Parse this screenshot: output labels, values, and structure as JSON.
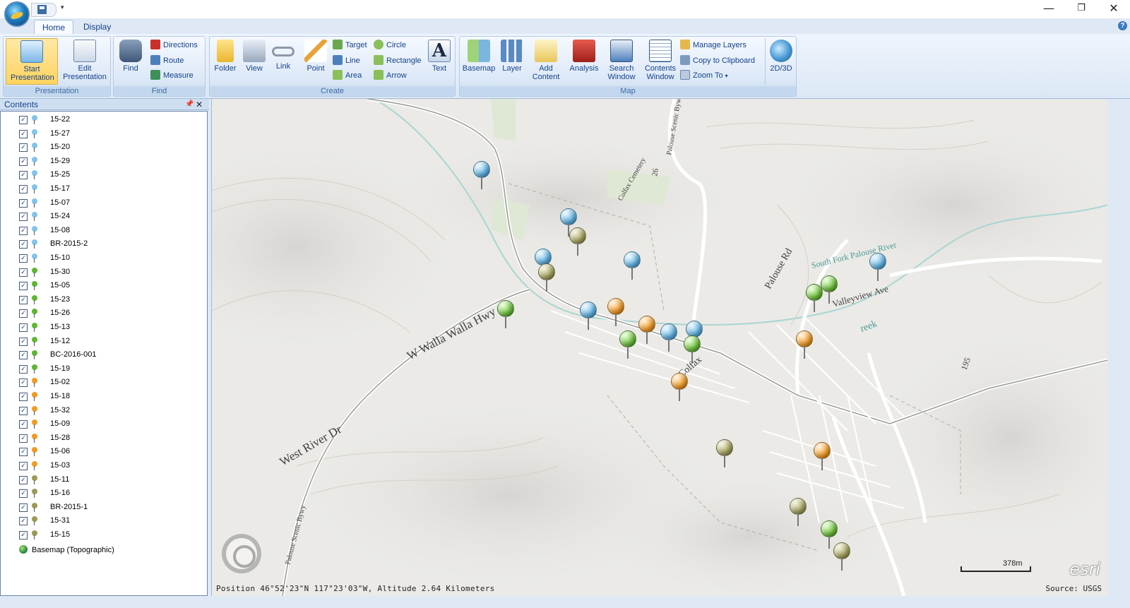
{
  "titlebar": {
    "qat_dropdown": "▾",
    "minimize": "—",
    "maximize": "❐",
    "close": "✕"
  },
  "tabs": [
    {
      "label": "Home"
    },
    {
      "label": "Display"
    }
  ],
  "ribbon": {
    "presentation": {
      "label": "Presentation",
      "start": "Start Presentation",
      "edit": "Edit Presentation"
    },
    "find": {
      "label": "Find",
      "find": "Find",
      "directions": "Directions",
      "route": "Route",
      "measure": "Measure"
    },
    "create": {
      "label": "Create",
      "folder": "Folder",
      "view": "View",
      "link": "Link",
      "point": "Point",
      "target": "Target",
      "line": "Line",
      "area": "Area",
      "circle": "Circle",
      "rectangle": "Rectangle",
      "arrow": "Arrow",
      "text": "Text"
    },
    "map": {
      "label": "Map",
      "basemap": "Basemap",
      "layer": "Layer",
      "add_content": "Add Content",
      "analysis": "Analysis",
      "search_window": "Search Window",
      "contents_window": "Contents Window",
      "manage_layers": "Manage Layers",
      "copy_clipboard": "Copy to Clipboard",
      "zoom_to": "Zoom To",
      "toggle_3d": "2D/3D"
    }
  },
  "contents": {
    "title": "Contents",
    "layers": [
      {
        "label": "15-22",
        "color": "#7fc4ec"
      },
      {
        "label": "15-27",
        "color": "#7fc4ec"
      },
      {
        "label": "15-20",
        "color": "#7fc4ec"
      },
      {
        "label": "15-29",
        "color": "#7fc4ec"
      },
      {
        "label": "15-25",
        "color": "#7fc4ec"
      },
      {
        "label": "15-17",
        "color": "#7fc4ec"
      },
      {
        "label": "15-07",
        "color": "#7fc4ec"
      },
      {
        "label": "15-24",
        "color": "#7fc4ec"
      },
      {
        "label": "15-08",
        "color": "#7fc4ec"
      },
      {
        "label": "BR-2015-2",
        "color": "#7fc4ec"
      },
      {
        "label": "15-10",
        "color": "#7fc4ec"
      },
      {
        "label": "15-30",
        "color": "#5cb82e"
      },
      {
        "label": "15-05",
        "color": "#5cb82e"
      },
      {
        "label": "15-23",
        "color": "#5cb82e"
      },
      {
        "label": "15-26",
        "color": "#5cb82e"
      },
      {
        "label": "15-13",
        "color": "#5cb82e"
      },
      {
        "label": "15-12",
        "color": "#5cb82e"
      },
      {
        "label": "BC-2016-001",
        "color": "#5cb82e"
      },
      {
        "label": "15-19",
        "color": "#5cb82e"
      },
      {
        "label": "15-02",
        "color": "#f39a22"
      },
      {
        "label": "15-18",
        "color": "#f39a22"
      },
      {
        "label": "15-32",
        "color": "#f39a22"
      },
      {
        "label": "15-09",
        "color": "#f39a22"
      },
      {
        "label": "15-28",
        "color": "#f39a22"
      },
      {
        "label": "15-06",
        "color": "#f39a22"
      },
      {
        "label": "15-03",
        "color": "#f39a22"
      },
      {
        "label": "15-11",
        "color": "#9a9a52"
      },
      {
        "label": "15-16",
        "color": "#9a9a52"
      },
      {
        "label": "BR-2015-1",
        "color": "#9a9a52"
      },
      {
        "label": "15-31",
        "color": "#9a9a52"
      },
      {
        "label": "15-15",
        "color": "#9a9a52"
      }
    ],
    "checked_glyph": "✓",
    "basemap": "Basemap (Topographic)"
  },
  "map": {
    "labels": {
      "w_walla": "W Walla Walla Hwy",
      "west_river": "West River Dr",
      "palouse_rd": "Palouse Rd",
      "south_fork": "South Fork Palouse River",
      "valleyview": "Valleyview Ave",
      "colfax": "Colfax",
      "cemetery": "Colfax Cemetery",
      "scenic": "Palouse Scenic Bywy",
      "creek": "reek",
      "hwy195": "195",
      "hwy26": "26"
    },
    "position": "Position 46°52'23\"N  117°23'03\"W, Altitude  2.64 Kilometers",
    "source": "Source: USGS",
    "logo": "esri",
    "scale": "378m"
  }
}
